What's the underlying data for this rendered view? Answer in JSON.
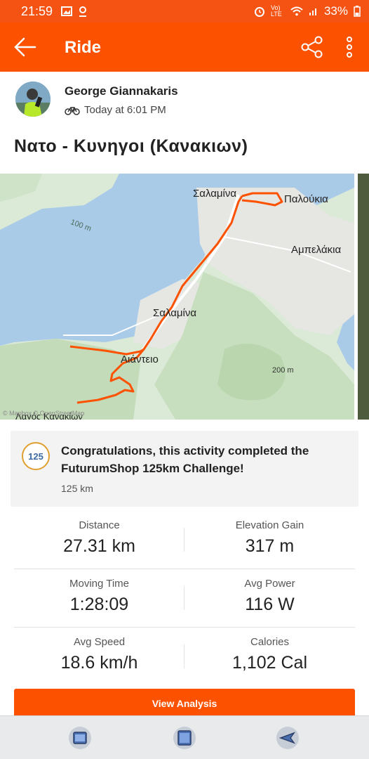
{
  "status_bar": {
    "time": "21:59",
    "battery": "33%",
    "network": "Vo) LTE"
  },
  "app_bar": {
    "title": "Ride",
    "icons": [
      "back-arrow-icon",
      "share-icon",
      "more-vert-icon"
    ]
  },
  "athlete": {
    "name": "George Giannakaris",
    "timestamp": "Today at 6:01 PM",
    "activity_type_icon": "bike-icon"
  },
  "activity": {
    "title": "Νατο - Κυνηγοι (Κανακιων)"
  },
  "map": {
    "labels": {
      "salamina_top": "Σαλαμίνα",
      "paloukia": "Παλούκια",
      "ampelakia": "Αμπελάκια",
      "salamina_mid": "Σαλαμίνα",
      "aianteio": "Αιάντειο",
      "contour_100": "100 m",
      "contour_200": "200 m",
      "bottom_place": "Λαγός Κανακίων",
      "attribution": "© Mapbox © OpenStreetMap"
    },
    "colors": {
      "water": "#a9cbe8",
      "land": "#dbe9d7",
      "route": "#fc5200"
    }
  },
  "challenge": {
    "badge_text": "125",
    "text": "Congratulations, this activity completed the FuturumShop 125km Challenge!",
    "sub": "125 km"
  },
  "stats": [
    {
      "left_label": "Distance",
      "left_value": "27.31 km",
      "right_label": "Elevation Gain",
      "right_value": "317 m"
    },
    {
      "left_label": "Moving Time",
      "left_value": "1:28:09",
      "right_label": "Avg Power",
      "right_value": "116 W"
    },
    {
      "left_label": "Avg Speed",
      "left_value": "18.6 km/h",
      "right_label": "Calories",
      "right_value": "1,102 Cal"
    }
  ],
  "cta": {
    "label": "View Analysis"
  },
  "nav_bar": {
    "icons": [
      "recent-apps-icon",
      "home-icon",
      "back-icon"
    ]
  },
  "colors": {
    "brand": "#fc5200",
    "status_bar": "#f45314"
  }
}
